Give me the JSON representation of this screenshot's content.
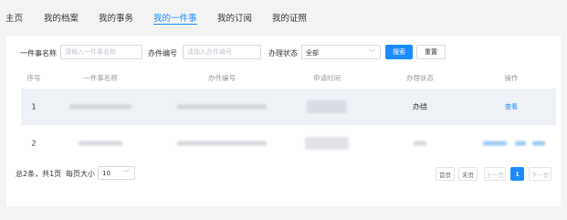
{
  "nav": {
    "items": [
      "主页",
      "我的档案",
      "我的事务",
      "我的一件事",
      "我的订阅",
      "我的证照"
    ],
    "active_index": 3
  },
  "filters": {
    "name_label": "一件事名称",
    "name_placeholder": "请输入一件事名称",
    "code_label": "办件编号",
    "code_placeholder": "请输入办件编号",
    "status_label": "办理状态",
    "status_value": "全部",
    "search_label": "搜索",
    "reset_label": "重置"
  },
  "table": {
    "headers": [
      "序号",
      "一件事名称",
      "办件编号",
      "申请时间",
      "办理状态",
      "操作"
    ],
    "rows": [
      {
        "index": "1",
        "status": "办结",
        "action": "查看"
      },
      {
        "index": "2",
        "status": "",
        "action": ""
      }
    ]
  },
  "pagination": {
    "total_text": "总2条，共1页",
    "page_size_label": "每页大小",
    "page_size": "10",
    "first": "首页",
    "last": "末页",
    "prev": "上一页",
    "current": "1",
    "next": "下一页"
  },
  "colors": {
    "accent": "#1a8cff",
    "row_highlight": "#eef1f6",
    "background": "#f3f3f3"
  }
}
